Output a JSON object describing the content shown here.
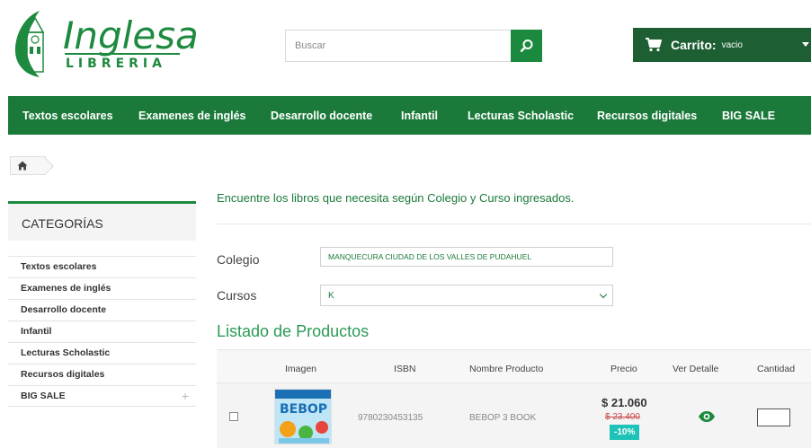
{
  "brand": {
    "name": "Inglesa",
    "subtitle": "LIBRERIA",
    "primary_color": "#1b7a3a",
    "accent_color": "#1b8a3e",
    "dark_color": "#1d5f33"
  },
  "search": {
    "placeholder": "Buscar",
    "icon": "search-icon"
  },
  "cart": {
    "label": "Carrito:",
    "status": "vacio",
    "icon": "cart-icon"
  },
  "nav": {
    "items": [
      "Textos escolares",
      "Examenes de inglés",
      "Desarrollo docente",
      "Infantil",
      "Lecturas Scholastic",
      "Recursos digitales",
      "BIG SALE"
    ]
  },
  "breadcrumb": {
    "icon": "home-icon"
  },
  "sidebar": {
    "title": "CATEGORÍAS",
    "items": [
      "Textos escolares",
      "Examenes de inglés",
      "Desarrollo docente",
      "Infantil",
      "Lecturas Scholastic",
      "Recursos digitales",
      "BIG SALE"
    ],
    "expand_symbol": "+"
  },
  "main": {
    "intro": "Encuentre los libros que necesita según Colegio y Curso ingresados.",
    "colegio_label": "Colegio",
    "colegio_value": "MANQUECURA CIUDAD DE LOS VALLES DE PUDAHUEL",
    "cursos_label": "Cursos",
    "cursos_value": "K",
    "list_title": "Listado de Productos"
  },
  "table": {
    "headers": [
      "Imagen",
      "ISBN",
      "Nombre Producto",
      "Precio",
      "Ver Detalle",
      "Cantidad"
    ],
    "rows": [
      {
        "isbn": "9780230453135",
        "name": "BEBOP 3 BOOK",
        "price": "$ 21.060",
        "old_price": "$ 23.400",
        "discount": "-10%",
        "cover_text": "BEBOP",
        "detail_icon": "eye-icon"
      }
    ]
  }
}
